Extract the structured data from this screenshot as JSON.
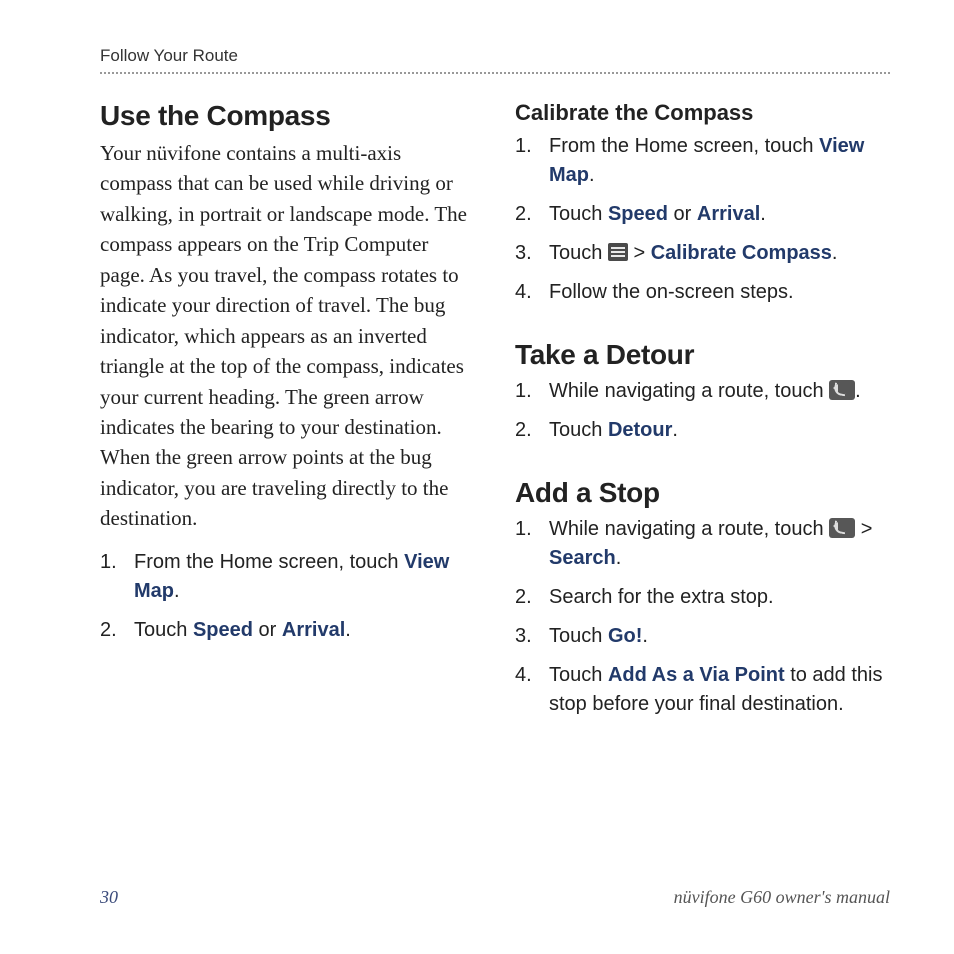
{
  "header": {
    "section_label": "Follow Your Route"
  },
  "left": {
    "h2": "Use the Compass",
    "para": "Your nüvifone contains a multi-axis compass that can be used while driving or walking, in portrait or landscape mode. The compass appears on the Trip Computer page. As you travel, the compass rotates to indicate your direction of travel. The bug indicator, which appears as an inverted triangle at the top of the compass, indicates your current heading. The green arrow indicates the bearing to your destination. When the green arrow points at the bug indicator, you are traveling directly to the destination.",
    "steps": {
      "s1_pre": "From the Home screen, touch ",
      "s1_view_map": "View Map",
      "s1_post": ".",
      "s2_pre": "Touch ",
      "s2_speed": "Speed",
      "s2_or": " or ",
      "s2_arrival": "Arrival",
      "s2_post": "."
    }
  },
  "right": {
    "calibrate": {
      "h3": "Calibrate the Compass",
      "s1_pre": "From the Home screen, touch ",
      "s1_view_map": "View Map",
      "s1_post": ".",
      "s2_pre": "Touch ",
      "s2_speed": "Speed",
      "s2_or": " or ",
      "s2_arrival": "Arrival",
      "s2_post": ".",
      "s3_pre": "Touch ",
      "s3_gt": " > ",
      "s3_cc": "Calibrate Compass",
      "s3_post": ".",
      "s4": "Follow the on-screen steps."
    },
    "detour": {
      "h2": "Take a Detour",
      "s1_pre": "While navigating a route, touch ",
      "s1_post": ".",
      "s2_pre": "Touch ",
      "s2_detour": "Detour",
      "s2_post": "."
    },
    "addstop": {
      "h2": "Add a Stop",
      "s1_pre": "While navigating a route, touch ",
      "s1_gt": " > ",
      "s1_search": "Search",
      "s1_post": ".",
      "s2": "Search for the extra stop.",
      "s3_pre": "Touch ",
      "s3_go": "Go!",
      "s3_post": ".",
      "s4_pre": "Touch ",
      "s4_via": "Add As a Via Point",
      "s4_post": " to add this stop before your final destination."
    }
  },
  "footer": {
    "page": "30",
    "title": "nüvifone G60 owner's manual"
  }
}
